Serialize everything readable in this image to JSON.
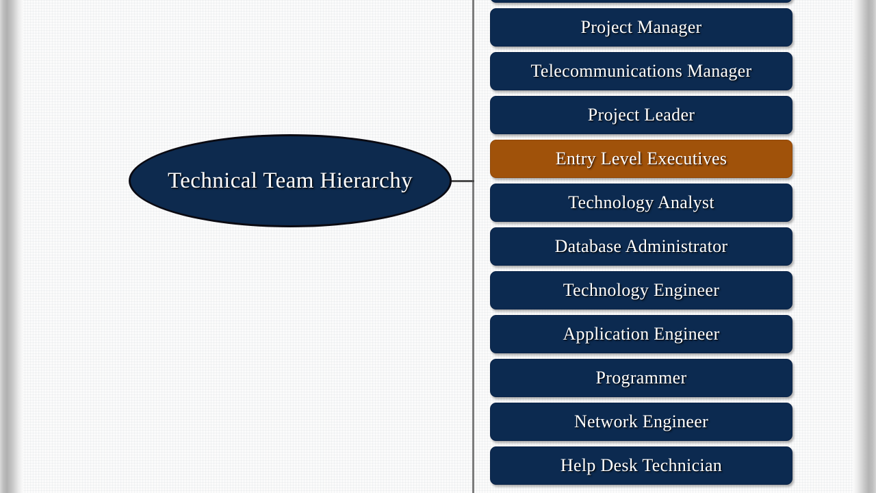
{
  "diagram": {
    "title": "Technical Team Hierarchy",
    "type": "radial-hierarchy-list",
    "root": {
      "label": "Technical Team Hierarchy",
      "shape": "ellipse",
      "fill_color": "#0d2a4e",
      "border_color": "#0a0a12",
      "text_color": "#ffffff"
    },
    "connector": {
      "spine_color": "#7b7b7b",
      "branch_color": "#4a4a4a"
    },
    "palette": {
      "node_fill": "#0c2a50",
      "highlight_fill": "#a0520a",
      "node_text": "#ffffff",
      "page_background": "#fbfbfb",
      "page_edge_shadow": "#b0b0b0"
    },
    "nodes": [
      {
        "label": "",
        "state": "default",
        "clipped": "top"
      },
      {
        "label": "Project Manager",
        "state": "default",
        "clipped": "none"
      },
      {
        "label": "Telecommunications Manager",
        "state": "default",
        "clipped": "none"
      },
      {
        "label": "Project Leader",
        "state": "default",
        "clipped": "none"
      },
      {
        "label": "Entry Level Executives",
        "state": "highlighted",
        "clipped": "none"
      },
      {
        "label": "Technology Analyst",
        "state": "default",
        "clipped": "none"
      },
      {
        "label": "Database Administrator",
        "state": "default",
        "clipped": "none"
      },
      {
        "label": "Technology Engineer",
        "state": "default",
        "clipped": "none"
      },
      {
        "label": "Application Engineer",
        "state": "default",
        "clipped": "none"
      },
      {
        "label": "Programmer",
        "state": "default",
        "clipped": "none"
      },
      {
        "label": "Network Engineer",
        "state": "default",
        "clipped": "none"
      },
      {
        "label": "Help Desk Technician",
        "state": "default",
        "clipped": "bottom"
      }
    ]
  }
}
